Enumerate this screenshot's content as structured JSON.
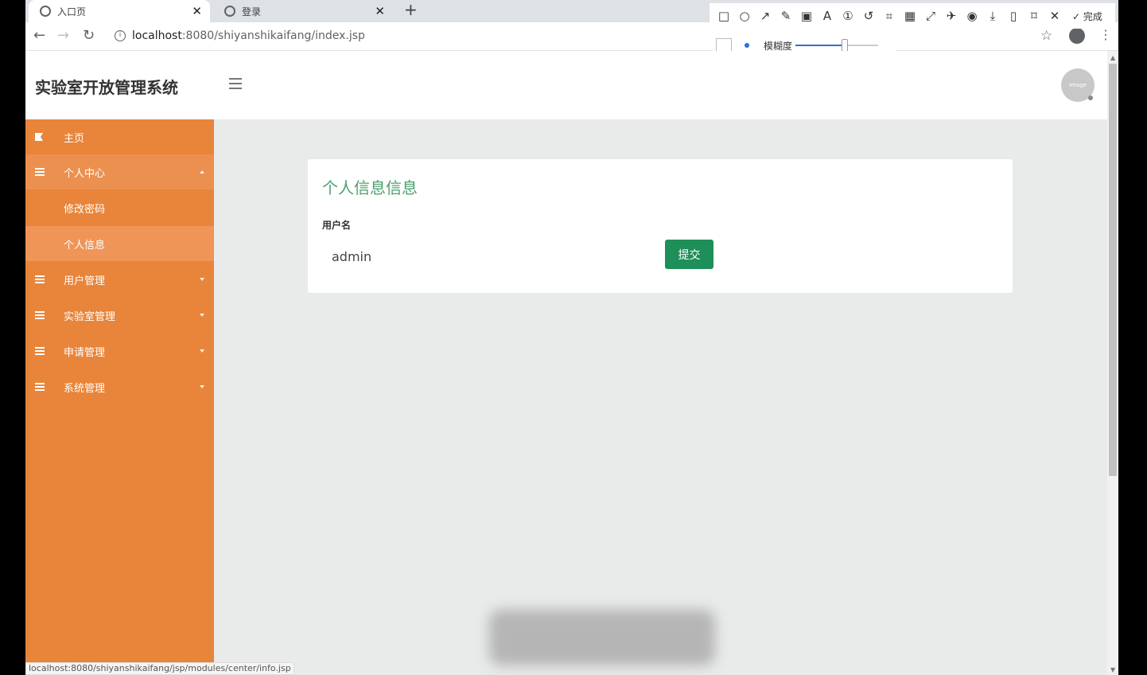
{
  "browser": {
    "tabs": [
      {
        "label": "入口页",
        "active": true
      },
      {
        "label": "登录",
        "active": false
      }
    ],
    "url_host": "localhost",
    "url_path": ":8080/shiyanshikaifang/index.jsp",
    "status_url": "localhost:8080/shiyanshikaifang/jsp/modules/center/info.jsp"
  },
  "snap_tool": {
    "done_label": "完成",
    "blur_label": "模糊度",
    "blur_level": 0.6
  },
  "header": {
    "title": "实验室开放管理系统",
    "avatar_text": "Image"
  },
  "sidebar": {
    "items": [
      {
        "label": "主页",
        "icon": "flag-icon"
      },
      {
        "label": "个人中心",
        "icon": "grid-icon",
        "expanded": true
      },
      {
        "label": "修改密码",
        "sub": true
      },
      {
        "label": "个人信息",
        "sub": true,
        "selected": true
      },
      {
        "label": "用户管理",
        "icon": "grid-icon"
      },
      {
        "label": "实验室管理",
        "icon": "grid-icon"
      },
      {
        "label": "申请管理",
        "icon": "grid-icon"
      },
      {
        "label": "系统管理",
        "icon": "grid-icon"
      }
    ]
  },
  "main": {
    "card_title": "个人信息信息",
    "username_label": "用户名",
    "username_value": "admin",
    "submit_label": "提交"
  },
  "colors": {
    "sidebar": "#e8853a",
    "accent_green": "#1f8f5a",
    "title_green": "#4aa06c",
    "content_bg": "#e8ebe9"
  }
}
